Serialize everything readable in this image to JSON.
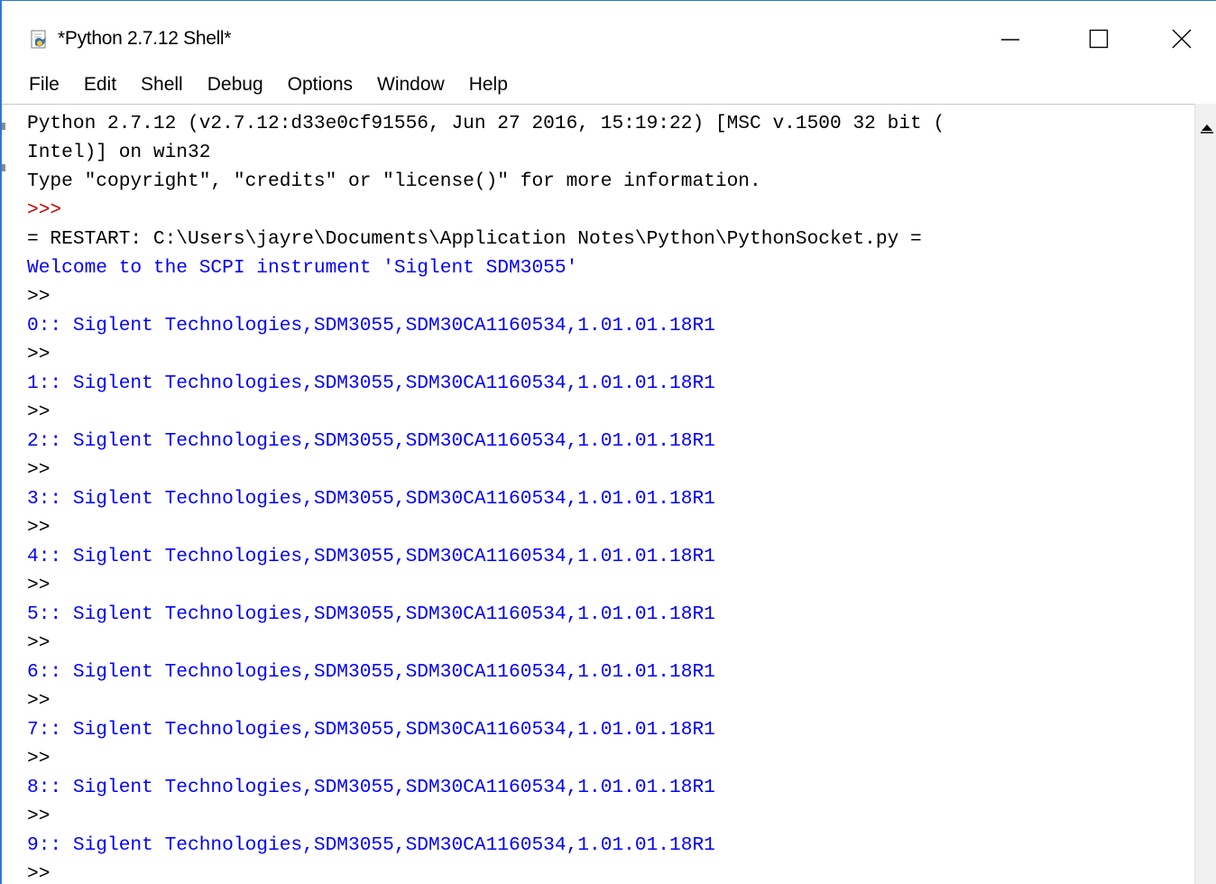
{
  "window": {
    "title": "*Python 2.7.12 Shell*"
  },
  "menu": [
    "File",
    "Edit",
    "Shell",
    "Debug",
    "Options",
    "Window",
    "Help"
  ],
  "shell": {
    "lines": [
      {
        "text": "Python 2.7.12 (v2.7.12:d33e0cf91556, Jun 27 2016, 15:19:22) [MSC v.1500 32 bit (",
        "style": "out"
      },
      {
        "text": "Intel)] on win32",
        "style": "out"
      },
      {
        "text": "Type \"copyright\", \"credits\" or \"license()\" for more information.",
        "style": "out"
      },
      {
        "text": ">>>",
        "style": "prompt3"
      },
      {
        "text": "= RESTART: C:\\Users\\jayre\\Documents\\Application Notes\\Python\\PythonSocket.py =",
        "style": "out"
      },
      {
        "text": "Welcome to the SCPI instrument 'Siglent SDM3055'",
        "style": "blue"
      },
      {
        "text": ">>",
        "style": "prompt2"
      },
      {
        "text": "0:: Siglent Technologies,SDM3055,SDM30CA1160534,1.01.01.18R1",
        "style": "blue"
      },
      {
        "text": ">>",
        "style": "prompt2"
      },
      {
        "text": "1:: Siglent Technologies,SDM3055,SDM30CA1160534,1.01.01.18R1",
        "style": "blue"
      },
      {
        "text": ">>",
        "style": "prompt2"
      },
      {
        "text": "2:: Siglent Technologies,SDM3055,SDM30CA1160534,1.01.01.18R1",
        "style": "blue"
      },
      {
        "text": ">>",
        "style": "prompt2"
      },
      {
        "text": "3:: Siglent Technologies,SDM3055,SDM30CA1160534,1.01.01.18R1",
        "style": "blue"
      },
      {
        "text": ">>",
        "style": "prompt2"
      },
      {
        "text": "4:: Siglent Technologies,SDM3055,SDM30CA1160534,1.01.01.18R1",
        "style": "blue"
      },
      {
        "text": ">>",
        "style": "prompt2"
      },
      {
        "text": "5:: Siglent Technologies,SDM3055,SDM30CA1160534,1.01.01.18R1",
        "style": "blue"
      },
      {
        "text": ">>",
        "style": "prompt2"
      },
      {
        "text": "6:: Siglent Technologies,SDM3055,SDM30CA1160534,1.01.01.18R1",
        "style": "blue"
      },
      {
        "text": ">>",
        "style": "prompt2"
      },
      {
        "text": "7:: Siglent Technologies,SDM3055,SDM30CA1160534,1.01.01.18R1",
        "style": "blue"
      },
      {
        "text": ">>",
        "style": "prompt2"
      },
      {
        "text": "8:: Siglent Technologies,SDM3055,SDM30CA1160534,1.01.01.18R1",
        "style": "blue"
      },
      {
        "text": ">>",
        "style": "prompt2"
      },
      {
        "text": "9:: Siglent Technologies,SDM3055,SDM30CA1160534,1.01.01.18R1",
        "style": "blue"
      },
      {
        "text": ">>",
        "style": "prompt2"
      }
    ]
  },
  "icons": {
    "app": "python-idle-icon",
    "minimize": "minimize-icon",
    "maximize": "maximize-icon",
    "close": "close-icon",
    "scroll_up": "scroll-up-arrow-icon"
  },
  "colors": {
    "output": "#000000",
    "prompt": "#c00000",
    "stdout": "#0000ff",
    "accent_border": "#2b79d6"
  }
}
